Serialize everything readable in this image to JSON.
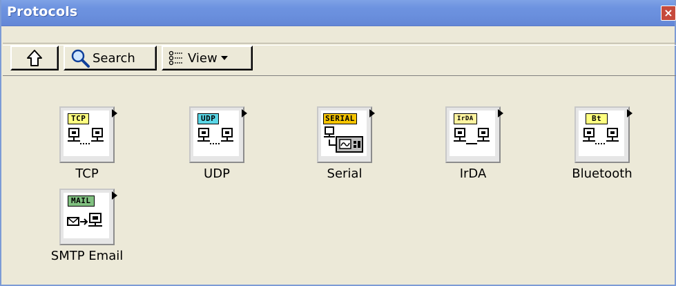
{
  "window": {
    "title": "Protocols",
    "close_icon": "close-icon"
  },
  "toolbar": {
    "up_icon": "up-arrow-icon",
    "search_label": "Search",
    "search_icon": "magnifier-icon",
    "view_label": "View",
    "view_icon": "view-list-icon"
  },
  "protocols": [
    {
      "label": "TCP",
      "badge": "TCP",
      "badge_color": "#ffff80"
    },
    {
      "label": "UDP",
      "badge": "UDP",
      "badge_color": "#5ad6e6"
    },
    {
      "label": "Serial",
      "badge": "SERIAL",
      "badge_color": "#f5c400"
    },
    {
      "label": "IrDA",
      "badge": "IrDA",
      "badge_color": "#fff4a0"
    },
    {
      "label": "Bluetooth",
      "badge": "Bt",
      "badge_color": "#ffff80"
    },
    {
      "label": "SMTP Email",
      "badge": "MAIL",
      "badge_color": "#80c080"
    }
  ]
}
